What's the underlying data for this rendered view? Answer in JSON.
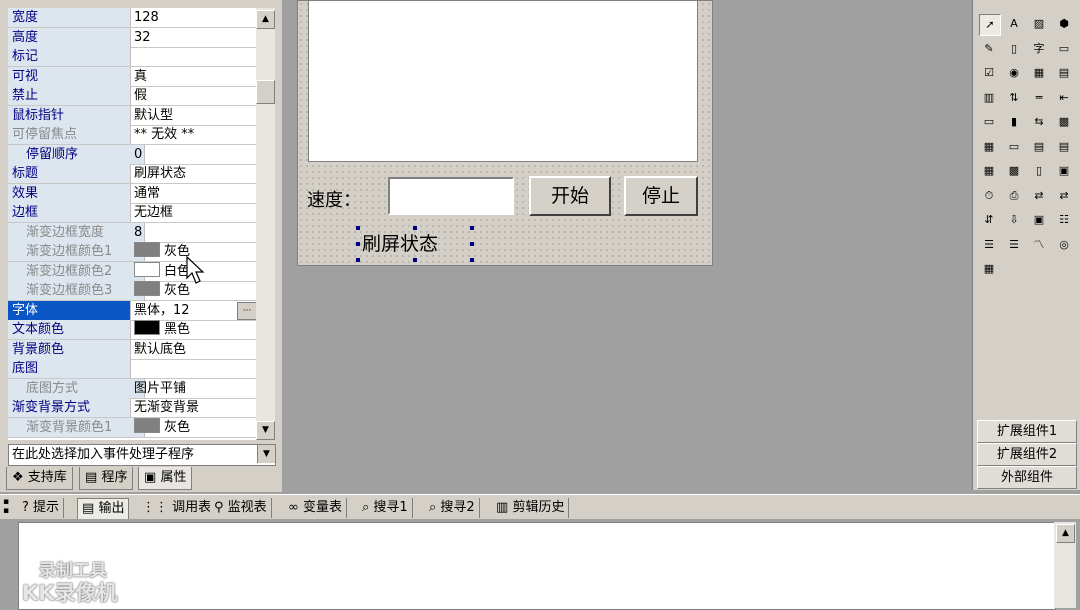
{
  "properties": [
    {
      "name": "宽度",
      "value": "128",
      "style": "normal"
    },
    {
      "name": "高度",
      "value": "32",
      "style": "normal"
    },
    {
      "name": "标记",
      "value": "",
      "style": "normal"
    },
    {
      "name": "可视",
      "value": "真",
      "style": "normal"
    },
    {
      "name": "禁止",
      "value": "假",
      "style": "normal"
    },
    {
      "name": "鼠标指针",
      "value": "默认型",
      "style": "normal"
    },
    {
      "name": "可停留焦点",
      "value": "** 无效 **",
      "style": "disabled"
    },
    {
      "name": "停留顺序",
      "value": "0",
      "style": "indent"
    },
    {
      "name": "标题",
      "value": "刷屏状态",
      "style": "normal"
    },
    {
      "name": "效果",
      "value": "通常",
      "style": "normal"
    },
    {
      "name": "边框",
      "value": "无边框",
      "style": "normal"
    },
    {
      "name": "渐变边框宽度",
      "value": "8",
      "style": "disabled-indent"
    },
    {
      "name": "渐变边框颜色1",
      "value": "灰色",
      "style": "disabled-indent",
      "swatch": "#808080"
    },
    {
      "name": "渐变边框颜色2",
      "value": "白色",
      "style": "disabled-indent",
      "swatch": "#ffffff"
    },
    {
      "name": "渐变边框颜色3",
      "value": "灰色",
      "style": "disabled-indent",
      "swatch": "#808080"
    },
    {
      "name": "字体",
      "value": "黑体，12",
      "style": "selected"
    },
    {
      "name": "文本颜色",
      "value": "黑色",
      "style": "normal",
      "swatch": "#000000"
    },
    {
      "name": "背景颜色",
      "value": "默认底色",
      "style": "normal"
    },
    {
      "name": "底图",
      "value": "",
      "style": "normal"
    },
    {
      "name": "底图方式",
      "value": "图片平铺",
      "style": "disabled-indent"
    },
    {
      "name": "渐变背景方式",
      "value": "无渐变背景",
      "style": "normal"
    },
    {
      "name": "渐变背景颜色1",
      "value": "灰色",
      "style": "disabled-indent",
      "swatch": "#808080"
    }
  ],
  "event_combo": "在此处选择加入事件处理子程序",
  "panel_tabs": [
    "支持库",
    "程序",
    "属性"
  ],
  "form": {
    "speed_label": "速度：",
    "speed_value": "",
    "start_button": "开始",
    "stop_button": "停止",
    "refresh_label": "刷屏状态"
  },
  "toolbox_buttons": [
    "扩展组件1",
    "扩展组件2",
    "外部组件"
  ],
  "toolbox_tools": [
    "pointer-icon",
    "label-icon",
    "picture-icon",
    "shape-icon",
    "edit-icon",
    "frame-icon",
    "text-icon",
    "groupbox-icon",
    "checkbox-icon",
    "radio-icon",
    "combo-icon",
    "listbox-icon",
    "grid-icon",
    "scroll-icon",
    "hscroll-icon",
    "ruler-icon",
    "progress-icon",
    "tab-icon",
    "split-icon",
    "graphics-icon",
    "calendar-icon",
    "button-icon",
    "date-icon",
    "doc-icon",
    "table-icon",
    "chart-icon",
    "slider-icon",
    "panel-icon",
    "timer-icon",
    "printer-icon",
    "data-icon",
    "link-icon",
    "tree-icon",
    "menu-icon",
    "window-icon",
    "list2-icon",
    "db-icon",
    "db2-icon",
    "graph-icon",
    "odbc-icon",
    "odbc2-icon"
  ],
  "output_tabs": [
    "提示",
    "输出",
    "调用表",
    "监视表",
    "变量表",
    "搜寻1",
    "搜寻2",
    "剪辑历史"
  ],
  "watermark": {
    "line1": "录制工具",
    "line2": "KK录像机"
  }
}
